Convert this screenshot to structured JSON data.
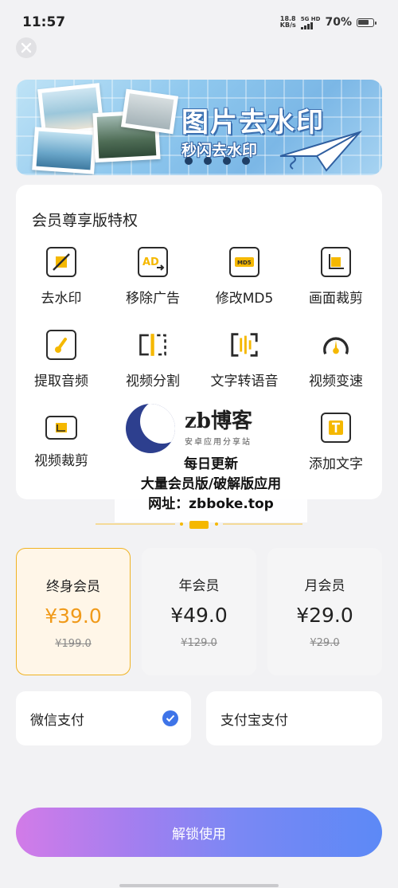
{
  "status_bar": {
    "time": "11:57",
    "net_speed_value": "18.8",
    "net_speed_unit": "KB/s",
    "network_type": "5G HD",
    "battery_percent": "70%"
  },
  "banner": {
    "title": "图片去水印",
    "subtitle": "秒闪去水印",
    "slide_count": 4
  },
  "privileges": {
    "title": "会员尊享版特权",
    "items": [
      {
        "label": "去水印",
        "icon": "remove-watermark-icon"
      },
      {
        "label": "移除广告",
        "icon": "remove-ads-icon"
      },
      {
        "label": "修改MD5",
        "icon": "md5-icon"
      },
      {
        "label": "画面裁剪",
        "icon": "crop-icon"
      },
      {
        "label": "提取音频",
        "icon": "extract-audio-icon"
      },
      {
        "label": "视频分割",
        "icon": "video-split-icon"
      },
      {
        "label": "文字转语音",
        "icon": "text-to-speech-icon"
      },
      {
        "label": "视频变速",
        "icon": "speed-icon"
      },
      {
        "label": "视频裁剪",
        "icon": "video-crop-icon"
      },
      {
        "label": "添加文字",
        "icon": "add-text-icon"
      }
    ]
  },
  "watermark_overlay": {
    "brand": "zb博客",
    "tagline": "安卓应用分享站",
    "line1": "每日更新",
    "line2": "大量会员版/破解版应用",
    "line3": "网址：zbboke.top"
  },
  "plans": [
    {
      "name": "终身会员",
      "price": "¥39.0",
      "original": "¥199.0",
      "selected": true
    },
    {
      "name": "年会员",
      "price": "¥49.0",
      "original": "¥129.0",
      "selected": false
    },
    {
      "name": "月会员",
      "price": "¥29.0",
      "original": "¥29.0",
      "selected": false
    }
  ],
  "payment": {
    "wechat_label": "微信支付",
    "alipay_label": "支付宝支付",
    "selected": "wechat"
  },
  "unlock_label": "解锁使用",
  "colors": {
    "accent_gold": "#f0b323",
    "price_orange": "#f09a1a",
    "check_blue": "#3e74e8",
    "button_gradient_start": "#d27be8",
    "button_gradient_end": "#5c89f6"
  }
}
